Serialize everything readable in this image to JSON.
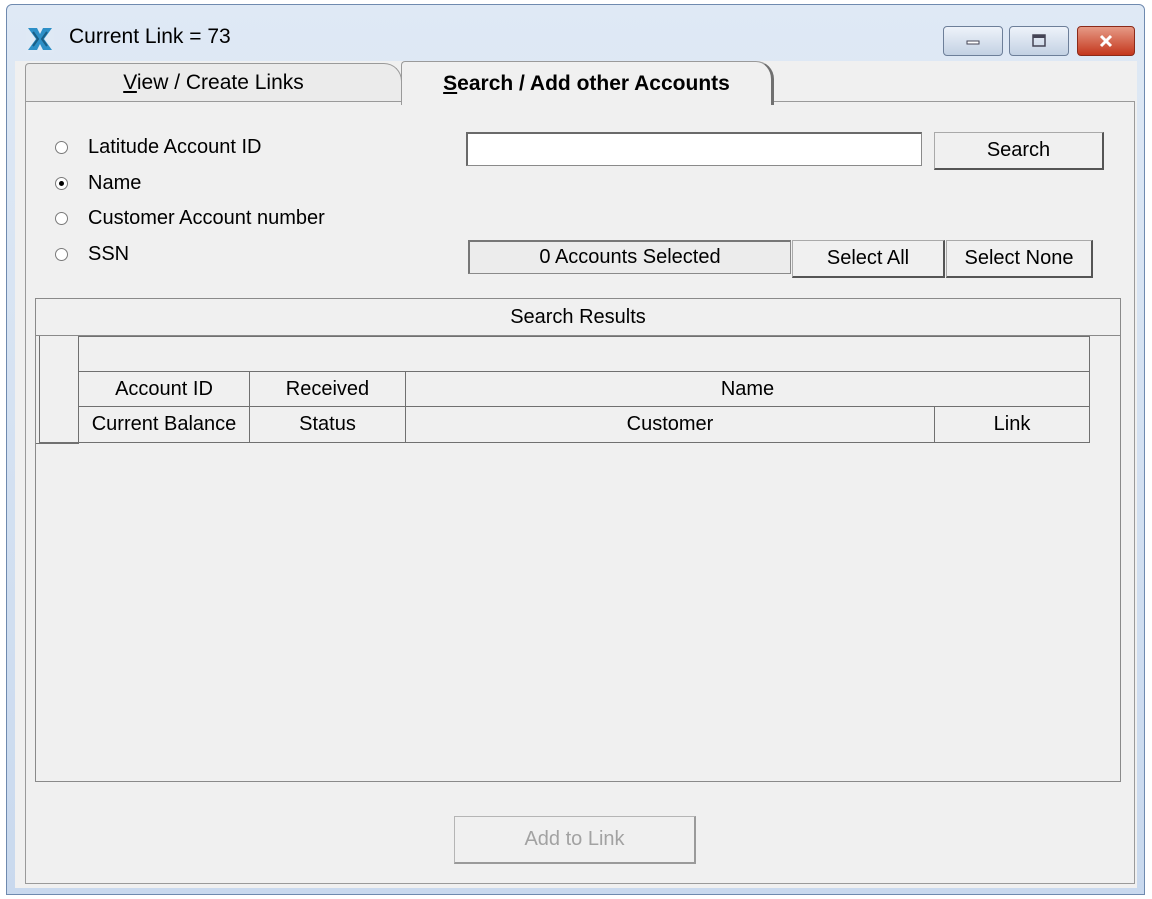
{
  "window": {
    "title": "Current Link = 73",
    "controls": {
      "minimize": "minimize-icon",
      "maximize": "maximize-icon",
      "close": "close-icon"
    }
  },
  "tabs": [
    {
      "label": "View / Create Links",
      "accel": "V",
      "rest": "iew / Create Links",
      "active": false
    },
    {
      "label": "Search / Add other Accounts",
      "accel": "S",
      "rest": "earch / Add other Accounts",
      "active": true
    }
  ],
  "search": {
    "options": [
      {
        "label": "Latitude Account ID",
        "checked": false
      },
      {
        "label": "Name",
        "checked": true
      },
      {
        "label": "Customer Account number",
        "checked": false
      },
      {
        "label": "SSN",
        "checked": false
      }
    ],
    "input_value": "",
    "search_button": "Search",
    "selected_count": "0 Accounts Selected",
    "select_all": "Select All",
    "select_none": "Select None"
  },
  "results": {
    "title": "Search Results",
    "header_row1": [
      "Account ID",
      "Received",
      "Name"
    ],
    "header_row2": [
      "Current Balance",
      "Status",
      "Customer",
      "Link"
    ]
  },
  "footer": {
    "add_button": "Add to Link"
  }
}
